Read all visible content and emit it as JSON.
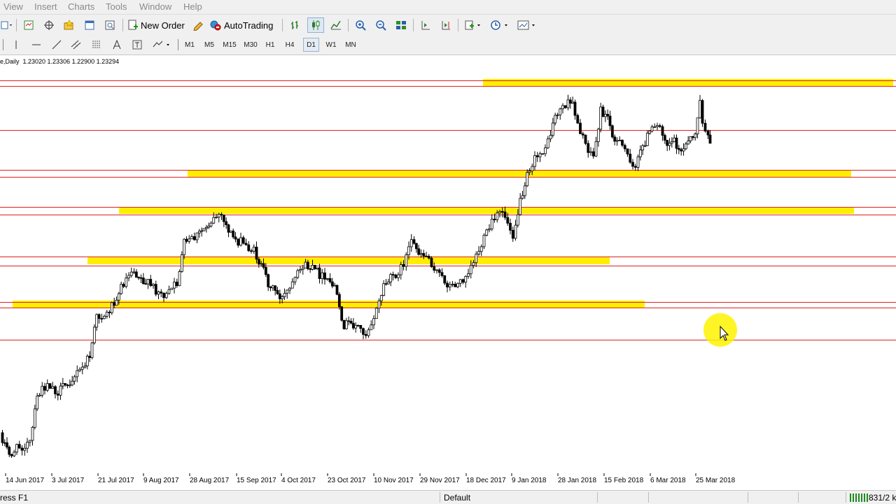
{
  "menu": [
    "View",
    "Insert",
    "Charts",
    "Tools",
    "Window",
    "Help"
  ],
  "toolbar": {
    "new_order_label": "New Order",
    "autotrading_label": "AutoTrading"
  },
  "timeframes": [
    "M1",
    "M5",
    "M15",
    "M30",
    "H1",
    "H4",
    "D1",
    "W1",
    "MN"
  ],
  "active_timeframe": "D1",
  "chart": {
    "header": "e,Daily  1.23020 1.23306 1.22900 1.23294"
  },
  "chart_data": {
    "type": "candlestick",
    "title": "e,Daily  1.23020 1.23306 1.22900 1.23294",
    "x_ticks": [
      "14 Jun 2017",
      "3 Jul 2017",
      "21 Jul 2017",
      "9 Aug 2017",
      "28 Aug 2017",
      "15 Sep 2017",
      "4 Oct 2017",
      "23 Oct 2017",
      "10 Nov 2017",
      "29 Nov 2017",
      "18 Dec 2017",
      "9 Jan 2018",
      "28 Jan 2018",
      "15 Feb 2018",
      "6 Mar 2018",
      "25 Mar 2018"
    ],
    "last_bar": {
      "open": 1.2302,
      "high": 1.23306,
      "low": 1.229,
      "close": 1.23294
    },
    "grid": false,
    "colors": {
      "horizontal_line": "#e02020",
      "zone_highlight": "#ffee00",
      "candle": "#000000"
    }
  },
  "status": {
    "help": "ress F1",
    "profile": "Default",
    "traffic": "831/2 k"
  }
}
